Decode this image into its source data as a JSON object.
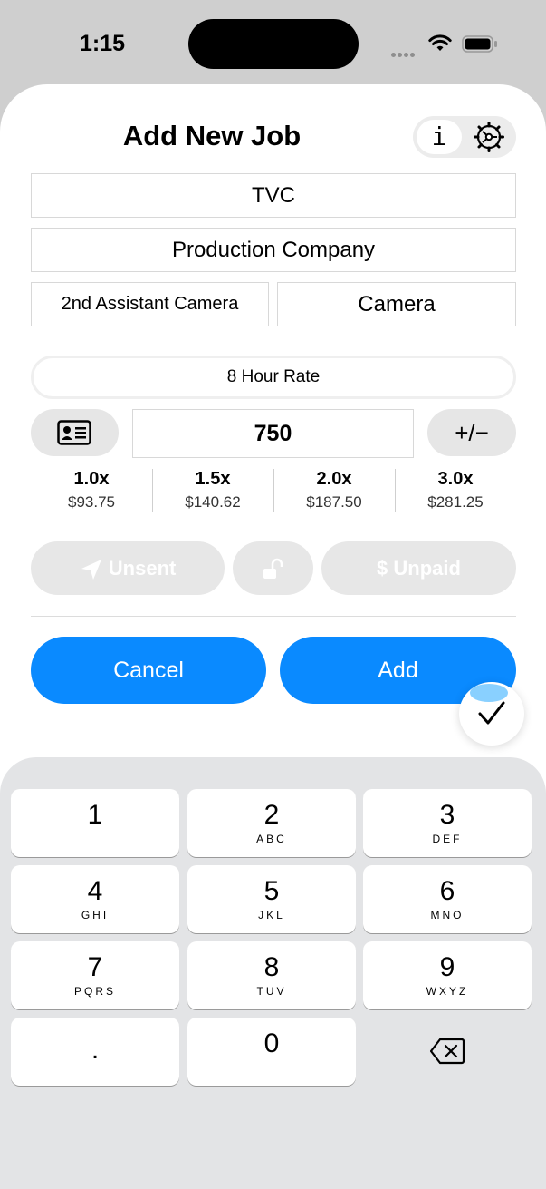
{
  "status_bar": {
    "time": "1:15"
  },
  "header": {
    "title": "Add New Job",
    "info_label": "i"
  },
  "fields": {
    "job_name": "TVC",
    "company": "Production Company",
    "position": "2nd Assistant Camera",
    "department": "Camera"
  },
  "rate": {
    "type_label": "8 Hour Rate",
    "value": "750",
    "adjust_label": "+/−"
  },
  "multipliers": [
    {
      "label": "1.0x",
      "amount": "$93.75"
    },
    {
      "label": "1.5x",
      "amount": "$140.62"
    },
    {
      "label": "2.0x",
      "amount": "$187.50"
    },
    {
      "label": "3.0x",
      "amount": "$281.25"
    }
  ],
  "status_buttons": {
    "sent": "Unsent",
    "paid": "Unpaid"
  },
  "actions": {
    "cancel": "Cancel",
    "add": "Add"
  },
  "keypad": [
    {
      "digit": "1",
      "letters": ""
    },
    {
      "digit": "2",
      "letters": "ABC"
    },
    {
      "digit": "3",
      "letters": "DEF"
    },
    {
      "digit": "4",
      "letters": "GHI"
    },
    {
      "digit": "5",
      "letters": "JKL"
    },
    {
      "digit": "6",
      "letters": "MNO"
    },
    {
      "digit": "7",
      "letters": "PQRS"
    },
    {
      "digit": "8",
      "letters": "TUV"
    },
    {
      "digit": "9",
      "letters": "WXYZ"
    },
    {
      "digit": ".",
      "letters": ""
    },
    {
      "digit": "0",
      "letters": ""
    }
  ],
  "colors": {
    "accent": "#0a8aff",
    "disabled": "#e7e7e7",
    "keyboard_bg": "#e3e4e6"
  }
}
